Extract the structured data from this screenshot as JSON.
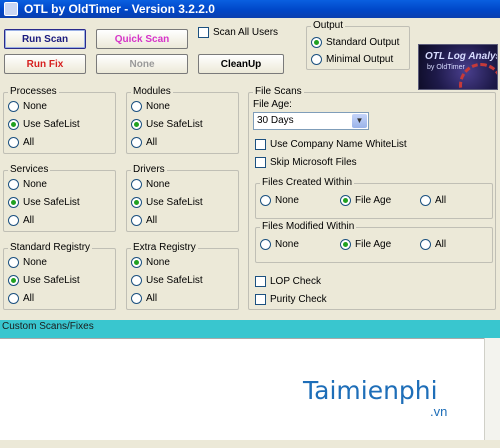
{
  "window": {
    "title": "OTL by OldTimer - Version 3.2.2.0"
  },
  "toolbar": {
    "run_scan": "Run Scan",
    "quick_scan": "Quick Scan",
    "run_fix": "Run Fix",
    "none": "None",
    "cleanup": "CleanUp",
    "scan_all_users": "Scan All Users"
  },
  "colors": {
    "run_scan": "#1a1a7e",
    "quick_scan": "#d633c8",
    "run_fix": "#d61f1f",
    "none_disabled": "#9a9a9a"
  },
  "output": {
    "title": "Output",
    "options": [
      "Standard Output",
      "Minimal Output"
    ],
    "selected": "Standard Output"
  },
  "logo": {
    "title": "OTL Log Analysis",
    "subtitle": "by OldTimer"
  },
  "groups": {
    "processes": {
      "title": "Processes",
      "options": [
        "None",
        "Use SafeList",
        "All"
      ],
      "selected": "Use SafeList"
    },
    "modules": {
      "title": "Modules",
      "options": [
        "None",
        "Use SafeList",
        "All"
      ],
      "selected": "Use SafeList"
    },
    "services": {
      "title": "Services",
      "options": [
        "None",
        "Use SafeList",
        "All"
      ],
      "selected": "Use SafeList"
    },
    "drivers": {
      "title": "Drivers",
      "options": [
        "None",
        "Use SafeList",
        "All"
      ],
      "selected": "Use SafeList"
    },
    "standard_registry": {
      "title": "Standard Registry",
      "options": [
        "None",
        "Use SafeList",
        "All"
      ],
      "selected": "Use SafeList"
    },
    "extra_registry": {
      "title": "Extra Registry",
      "options": [
        "None",
        "Use SafeList",
        "All"
      ],
      "selected": "None"
    }
  },
  "file_scans": {
    "title": "File Scans",
    "file_age_label": "File Age:",
    "file_age_value": "30 Days",
    "company_whitelist": "Use Company Name WhiteList",
    "skip_microsoft": "Skip Microsoft Files",
    "created": {
      "title": "Files Created Within",
      "options": [
        "None",
        "File Age",
        "All"
      ],
      "selected": "File Age"
    },
    "modified": {
      "title": "Files Modified Within",
      "options": [
        "None",
        "File Age",
        "All"
      ],
      "selected": "File Age"
    },
    "lop_check": "LOP Check",
    "purity_check": "Purity Check"
  },
  "custom_scans": {
    "label": "Custom Scans/Fixes"
  },
  "watermark": {
    "brand": "Taimienphi",
    "domain": ".vn"
  }
}
